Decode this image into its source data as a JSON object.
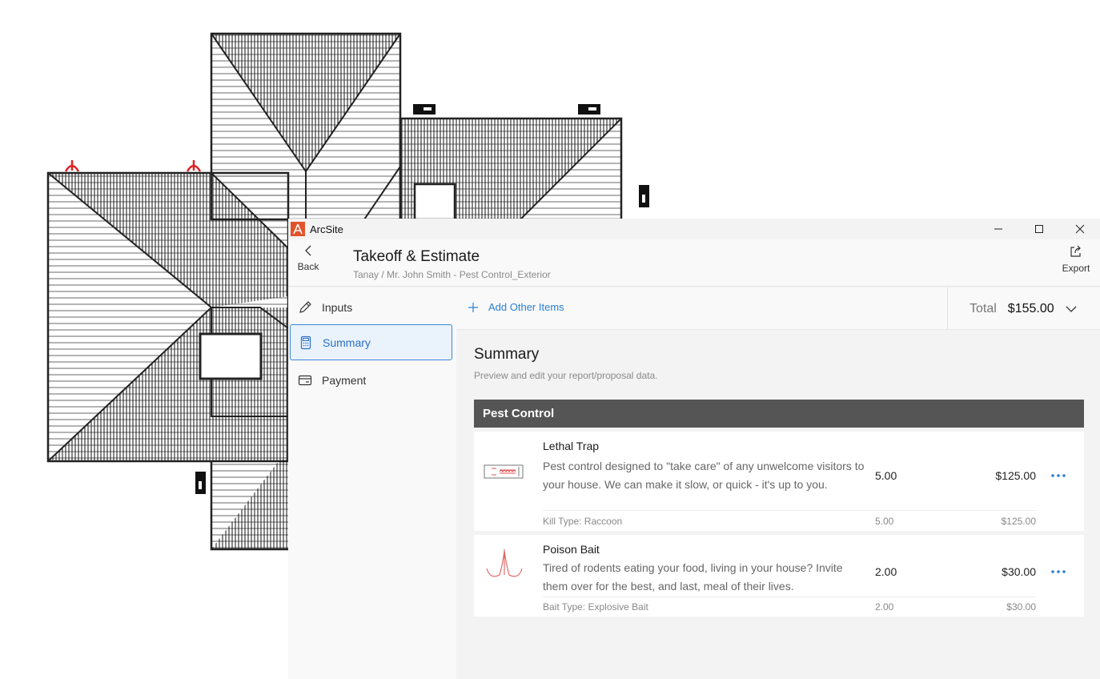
{
  "app": {
    "name": "ArcSite"
  },
  "header": {
    "back_label": "Back",
    "title": "Takeoff & Estimate",
    "breadcrumb": "Tanay / Mr. John Smith - Pest Control_Exterior",
    "export_label": "Export"
  },
  "sidebar": {
    "items": [
      {
        "label": "Inputs",
        "icon": "pencil-icon",
        "active": false
      },
      {
        "label": "Summary",
        "icon": "calculator-icon",
        "active": true
      },
      {
        "label": "Payment",
        "icon": "card-icon",
        "active": false
      }
    ]
  },
  "toolbar": {
    "add_items_label": "Add Other Items",
    "total_label": "Total",
    "total_value": "$155.00"
  },
  "summary": {
    "title": "Summary",
    "subtitle": "Preview and edit your report/proposal data.",
    "category": "Pest Control",
    "items": [
      {
        "name": "Lethal Trap",
        "description": "Pest control designed to \"take care\" of any unwelcome visitors to your house. We can make it slow, or quick - it's up to you.",
        "quantity": "5.00",
        "price": "$125.00",
        "option_label": "Kill Type: Raccoon",
        "option_quantity": "5.00",
        "option_price": "$125.00"
      },
      {
        "name": "Poison Bait",
        "description": "Tired of rodents eating your food, living in your house? Invite them over for the best, and last, meal of their lives.",
        "quantity": "2.00",
        "price": "$30.00",
        "option_label": "Bait Type: Explosive Bait",
        "option_quantity": "2.00",
        "option_price": "$30.00"
      }
    ]
  },
  "colors": {
    "accent": "#2a7fd4",
    "logo": "#e2532a",
    "category_header": "#555555",
    "bait_marker": "#e02020"
  }
}
